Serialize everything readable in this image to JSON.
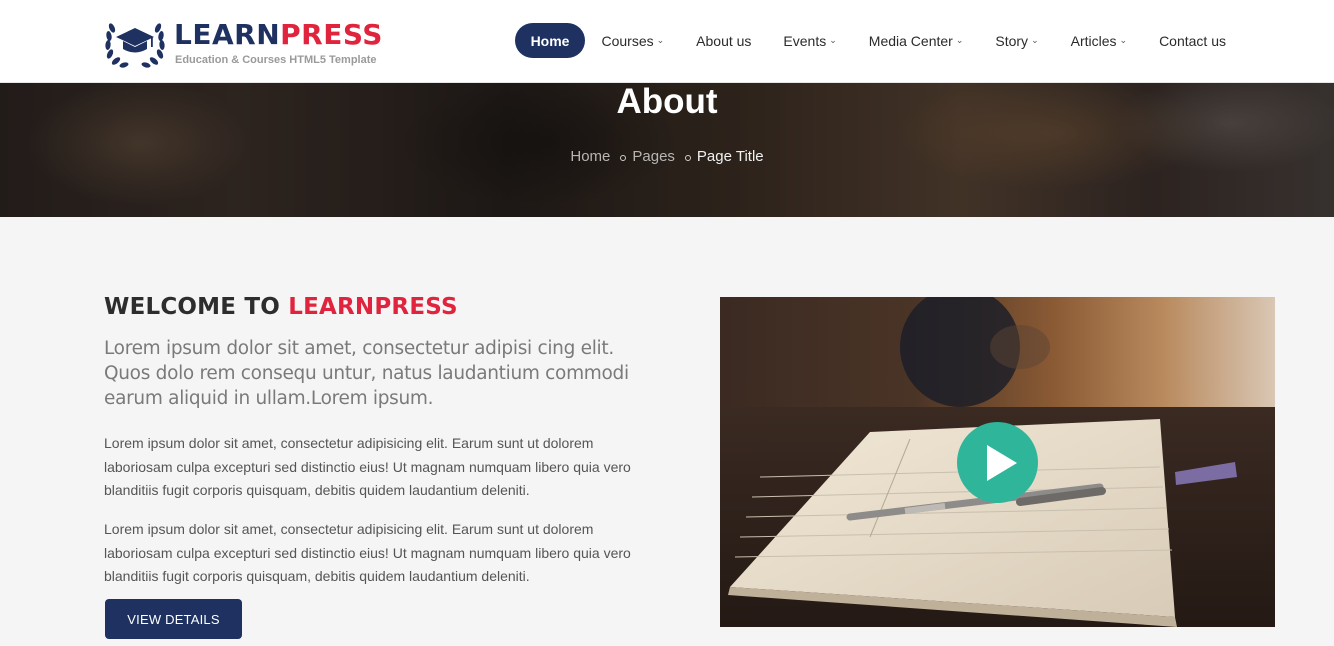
{
  "brand": {
    "name_part1": "LEARN",
    "name_part2": "PRESS",
    "tagline": "Education & Courses HTML5 Template"
  },
  "nav": {
    "items": [
      {
        "label": "Home",
        "active": true,
        "has_dropdown": false
      },
      {
        "label": "Courses",
        "active": false,
        "has_dropdown": true
      },
      {
        "label": "About us",
        "active": false,
        "has_dropdown": false
      },
      {
        "label": "Events",
        "active": false,
        "has_dropdown": true
      },
      {
        "label": "Media Center",
        "active": false,
        "has_dropdown": true
      },
      {
        "label": "Story",
        "active": false,
        "has_dropdown": true
      },
      {
        "label": "Articles",
        "active": false,
        "has_dropdown": true
      },
      {
        "label": "Contact us",
        "active": false,
        "has_dropdown": false
      }
    ],
    "dropdown_icon": "chevron-down-icon"
  },
  "hero": {
    "title": "About",
    "breadcrumb": [
      "Home",
      "Pages",
      "Page Title"
    ]
  },
  "about": {
    "title_part1": "WELCOME TO ",
    "title_part2": "LEARNPRESS",
    "lead": "Lorem ipsum dolor sit amet, consectetur adipisi cing elit. Quos dolo rem consequ untur, natus laudantium commodi earum aliquid in ullam.Lorem ipsum.",
    "paragraph1": "Lorem ipsum dolor sit amet, consectetur adipisicing elit. Earum sunt ut dolorem laboriosam culpa excepturi sed distinctio eius! Ut magnam numquam libero quia vero blanditiis fugit corporis quisquam, debitis quidem laudantium deleniti.",
    "paragraph2": "Lorem ipsum dolor sit amet, consectetur adipisicing elit. Earum sunt ut dolorem laboriosam culpa excepturi sed distinctio eius! Ut magnam numquam libero quia vero blanditiis fugit corporis quisquam, debitis quidem laudantium deleniti.",
    "button_label": "VIEW DETAILS"
  },
  "video": {
    "play_icon": "play-icon"
  },
  "colors": {
    "primary": "#1e3161",
    "accent": "#e0243d",
    "play": "#2fb59a"
  }
}
